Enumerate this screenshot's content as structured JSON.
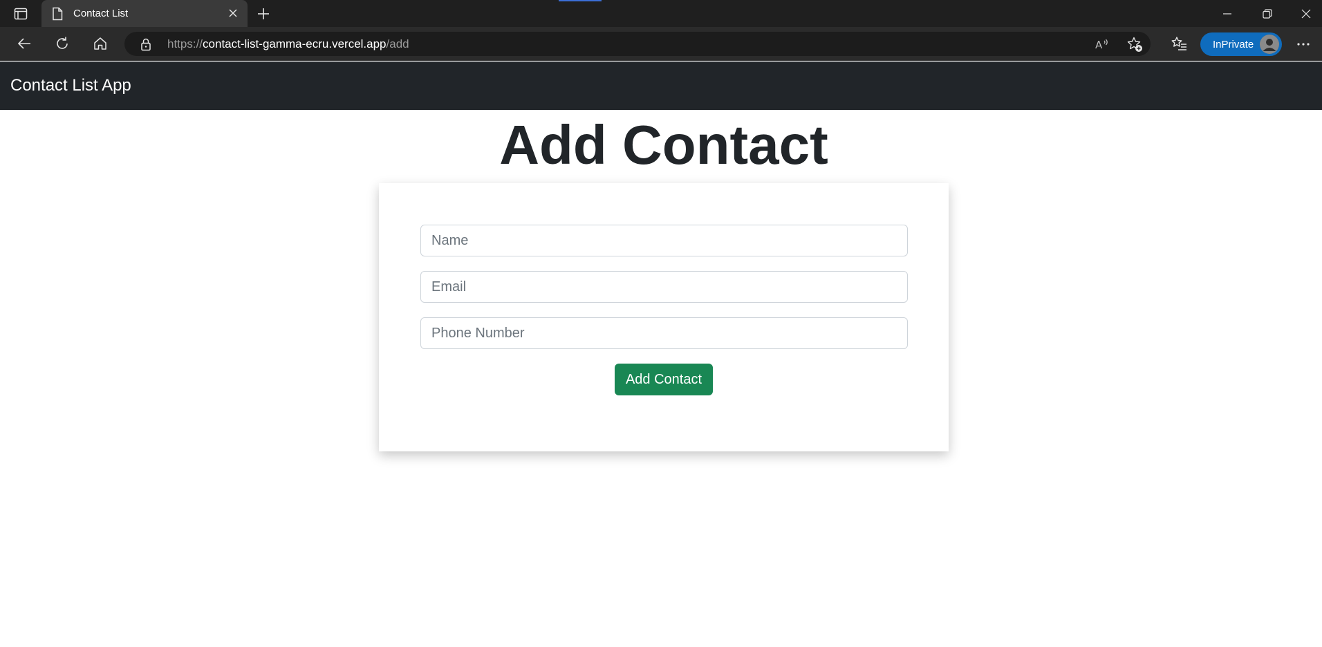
{
  "browser": {
    "tab_title": "Contact List",
    "url": {
      "protocol": "https://",
      "host": "contact-list-gamma-ecru.vercel.app",
      "path": "/add"
    },
    "inprivate_label": "InPrivate",
    "icons": {
      "tab_actions": "tab-actions-icon",
      "page": "page-icon",
      "close_tab": "close-icon",
      "new_tab": "plus-icon",
      "back": "back-arrow-icon",
      "refresh": "refresh-icon",
      "home": "home-icon",
      "lock": "lock-icon",
      "read_aloud": "read-aloud-icon",
      "add_favorite": "star-add-icon",
      "favorites": "favorites-list-icon",
      "more": "more-icon",
      "minimize": "minimize-icon",
      "restore": "restore-icon",
      "close_window": "close-icon"
    }
  },
  "app": {
    "brand": "Contact List App",
    "page_title": "Add Contact",
    "form": {
      "name_placeholder": "Name",
      "name_value": "",
      "email_placeholder": "Email",
      "email_value": "",
      "phone_placeholder": "Phone Number",
      "phone_value": "",
      "submit_label": "Add Contact"
    }
  },
  "colors": {
    "navbar": "#212529",
    "submit_button": "#198754",
    "inprivate_badge": "#0f6cbd",
    "browser_chrome": "#1f1f1f"
  }
}
